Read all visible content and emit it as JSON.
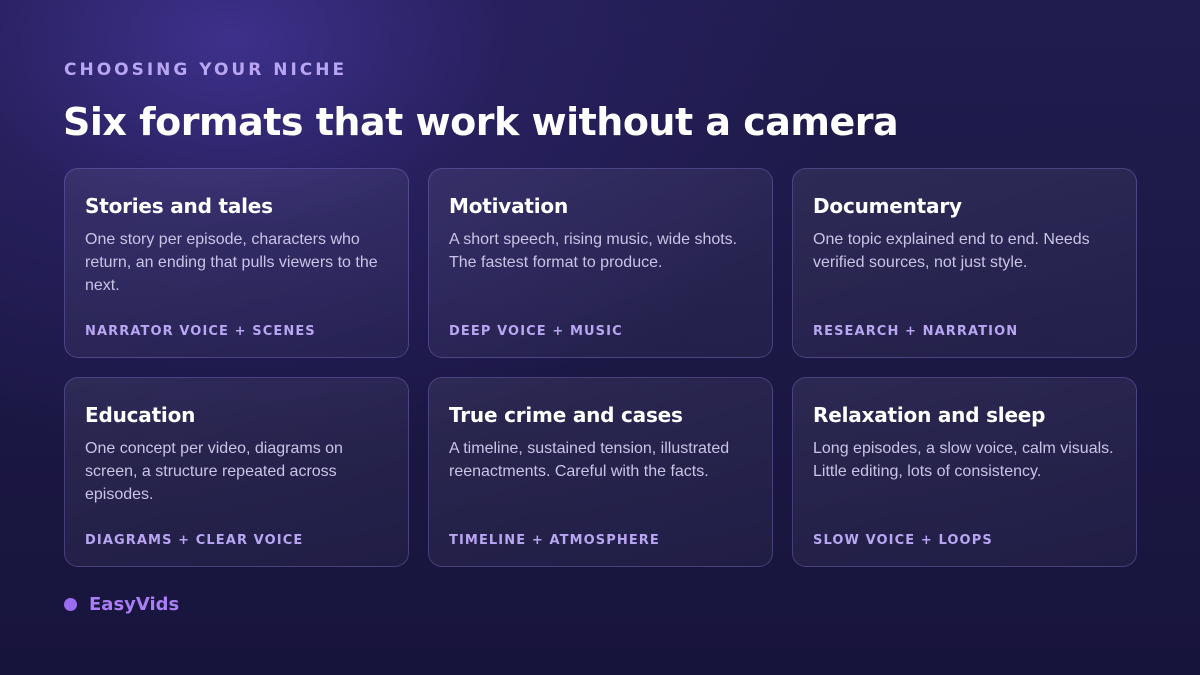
{
  "header": {
    "eyebrow": "CHOOSING YOUR NICHE",
    "title": "Six formats that work without a camera"
  },
  "cards": [
    {
      "title": "Stories and tales",
      "description": "One story per episode, characters who return, an ending that pulls viewers to the next.",
      "tag": "NARRATOR VOICE + SCENES"
    },
    {
      "title": "Motivation",
      "description": "A short speech, rising music, wide shots. The fastest format to produce.",
      "tag": "DEEP VOICE + MUSIC"
    },
    {
      "title": "Documentary",
      "description": "One topic explained end to end. Needs verified sources, not just style.",
      "tag": "RESEARCH + NARRATION"
    },
    {
      "title": "Education",
      "description": "One concept per video, diagrams on screen, a structure repeated across episodes.",
      "tag": "DIAGRAMS + CLEAR VOICE"
    },
    {
      "title": "True crime and cases",
      "description": "A timeline, sustained tension, illustrated reenactments. Careful with the facts.",
      "tag": "TIMELINE + ATMOSPHERE"
    },
    {
      "title": "Relaxation and sleep",
      "description": "Long episodes, a slow voice, calm visuals. Little editing, lots of consistency.",
      "tag": "SLOW VOICE + LOOPS"
    }
  ],
  "brand": {
    "name": "EasyVids",
    "accent_color": "#9a6cf0"
  },
  "colors": {
    "background": "#1c1848",
    "eyebrow_and_tags": "#b9a6f2",
    "body_text": "#c9c4e6"
  }
}
